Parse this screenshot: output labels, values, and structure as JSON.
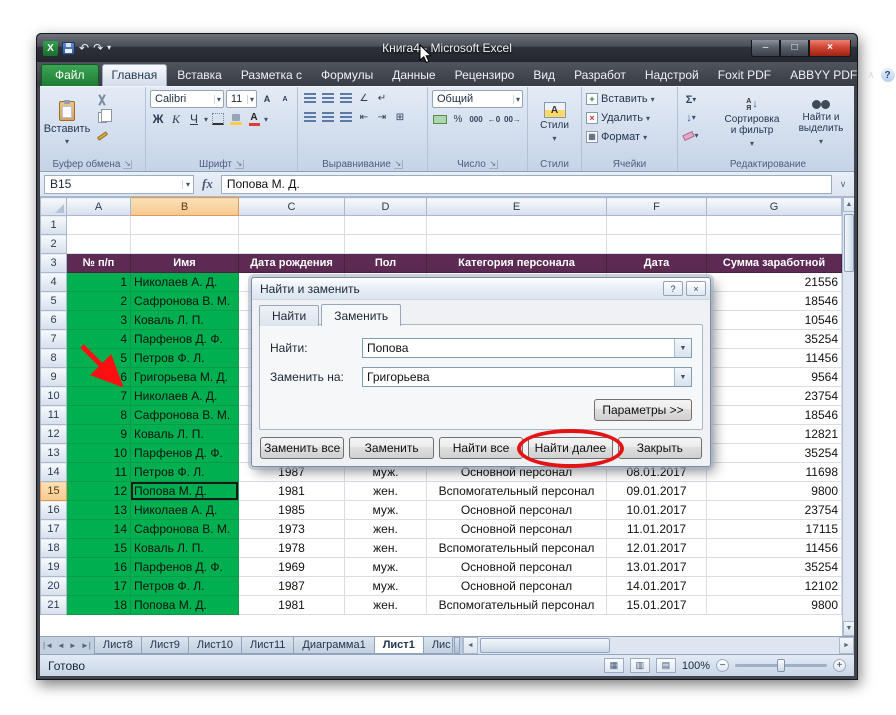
{
  "colors": {
    "cell_green": "#00b050",
    "header_purple": "#5c2a52",
    "annotation_red": "#e51414",
    "selection_orange": "#f6c98f",
    "file_tab_green": "#1d7c35"
  },
  "icons": {
    "dropdown": "▾",
    "dropdown_small": "▼",
    "minimize": "–",
    "maximize": "□",
    "close": "×",
    "help": "?",
    "collapse_ribbon": "∧",
    "undo": "↶",
    "redo": "↷",
    "up": "▲",
    "down": "▼",
    "left": "◄",
    "right": "►",
    "nav_first": "|◄",
    "nav_prev": "◄",
    "nav_next": "►",
    "nav_last": "►|",
    "view_normal": "▦",
    "view_layout": "▥",
    "view_break": "▤",
    "zoom_minus": "−",
    "zoom_plus": "+",
    "formula_expand": "∨",
    "decimal_increase": "←0",
    "decimal_decrease": "00→",
    "wrap_text": "↵",
    "orientation": "∠",
    "merge": "⊞",
    "indent_left": "⇤",
    "indent_right": "⇥",
    "borders": "⊞",
    "fill_arrow": "↓"
  },
  "titlebar": {
    "title": "Книга4  -  Microsoft Excel"
  },
  "ribbon_tabs": [
    {
      "label": "Файл",
      "file": true
    },
    {
      "label": "Главная",
      "active": true
    },
    {
      "label": "Вставка"
    },
    {
      "label": "Разметка с"
    },
    {
      "label": "Формулы"
    },
    {
      "label": "Данные"
    },
    {
      "label": "Рецензиро"
    },
    {
      "label": "Вид"
    },
    {
      "label": "Разработ"
    },
    {
      "label": "Надстрой"
    },
    {
      "label": "Foxit PDF"
    },
    {
      "label": "ABBYY PDF"
    }
  ],
  "ribbon": {
    "clipboard": {
      "label": "Буфер обмена",
      "paste": "Вставить"
    },
    "font": {
      "label": "Шрифт",
      "family": "Calibri",
      "size": "11",
      "bold": "Ж",
      "italic": "К",
      "underline": "Ч",
      "fontcolor": "А",
      "grow": "А",
      "shrink": "А"
    },
    "alignment": {
      "label": "Выравнивание"
    },
    "number": {
      "label": "Число",
      "format": "Общий",
      "percent": "%",
      "thousands": "000"
    },
    "styles": {
      "label": "Стили",
      "button": "Стили",
      "icon_letter": "А"
    },
    "cells": {
      "label": "Ячейки",
      "insert": "Вставить",
      "delete": "Удалить",
      "format": "Формат"
    },
    "editing": {
      "label": "Редактирование",
      "sum": "Σ",
      "sort": "Сортировка и фильтр",
      "find": "Найти и выделить"
    }
  },
  "formula_bar": {
    "name_box": "B15",
    "fx": "fx",
    "value": "Попова М. Д."
  },
  "grid": {
    "columns": [
      "A",
      "B",
      "C",
      "D",
      "E",
      "F",
      "G"
    ],
    "selected_column": "B",
    "selected_row": 15,
    "active_cell": "B15",
    "rows": [
      {
        "num": "1",
        "kind": "empty",
        "cells": [
          "",
          "",
          "",
          "",
          "",
          "",
          ""
        ]
      },
      {
        "num": "2",
        "kind": "empty",
        "cells": [
          "",
          "",
          "",
          "",
          "",
          "",
          ""
        ]
      },
      {
        "num": "3",
        "kind": "header",
        "cells": [
          "№ п/п",
          "Имя",
          "Дата рождения",
          "Пол",
          "Категория персонала",
          "Дата",
          "Сумма заработной"
        ]
      },
      {
        "num": "4",
        "kind": "data",
        "cells": [
          "1",
          "Николаев А. Д.",
          "",
          "",
          "",
          "",
          "21556"
        ]
      },
      {
        "num": "5",
        "kind": "data",
        "cells": [
          "2",
          "Сафронова В. М.",
          "",
          "",
          "",
          "",
          "18546"
        ]
      },
      {
        "num": "6",
        "kind": "data",
        "cells": [
          "3",
          "Коваль Л. П.",
          "",
          "",
          "",
          "",
          "10546"
        ]
      },
      {
        "num": "7",
        "kind": "data",
        "cells": [
          "4",
          "Парфенов Д. Ф.",
          "",
          "",
          "",
          "",
          "35254"
        ]
      },
      {
        "num": "8",
        "kind": "data",
        "cells": [
          "5",
          "Петров Ф. Л.",
          "",
          "",
          "",
          "",
          "11456"
        ]
      },
      {
        "num": "9",
        "kind": "data",
        "cells": [
          "6",
          "Григорьева М. Д.",
          "",
          "",
          "",
          "",
          "9564"
        ]
      },
      {
        "num": "10",
        "kind": "data",
        "cells": [
          "7",
          "Николаев А. Д.",
          "",
          "",
          "",
          "",
          "23754"
        ]
      },
      {
        "num": "11",
        "kind": "data",
        "cells": [
          "8",
          "Сафронова В. М.",
          "",
          "",
          "",
          "",
          "18546"
        ]
      },
      {
        "num": "12",
        "kind": "data",
        "cells": [
          "9",
          "Коваль Л. П.",
          "",
          "",
          "",
          "",
          "12821"
        ]
      },
      {
        "num": "13",
        "kind": "data",
        "cells": [
          "10",
          "Парфенов Д. Ф.",
          "",
          "",
          "",
          "",
          "35254"
        ]
      },
      {
        "num": "14",
        "kind": "data",
        "cells": [
          "11",
          "Петров Ф. Л.",
          "1987",
          "муж.",
          "Основной персонал",
          "08.01.2017",
          "11698"
        ]
      },
      {
        "num": "15",
        "kind": "data",
        "cells": [
          "12",
          "Попова М. Д.",
          "1981",
          "жен.",
          "Вспомогательный персонал",
          "09.01.2017",
          "9800"
        ]
      },
      {
        "num": "16",
        "kind": "data",
        "cells": [
          "13",
          "Николаев А. Д.",
          "1985",
          "муж.",
          "Основной персонал",
          "10.01.2017",
          "23754"
        ]
      },
      {
        "num": "17",
        "kind": "data",
        "cells": [
          "14",
          "Сафронова В. М.",
          "1973",
          "жен.",
          "Основной персонал",
          "11.01.2017",
          "17115"
        ]
      },
      {
        "num": "18",
        "kind": "data",
        "cells": [
          "15",
          "Коваль Л. П.",
          "1978",
          "жен.",
          "Вспомогательный персонал",
          "12.01.2017",
          "11456"
        ]
      },
      {
        "num": "19",
        "kind": "data",
        "cells": [
          "16",
          "Парфенов Д. Ф.",
          "1969",
          "муж.",
          "Основной персонал",
          "13.01.2017",
          "35254"
        ]
      },
      {
        "num": "20",
        "kind": "data",
        "cells": [
          "17",
          "Петров Ф. Л.",
          "1987",
          "муж.",
          "Основной персонал",
          "14.01.2017",
          "12102"
        ]
      },
      {
        "num": "21",
        "kind": "data",
        "cells": [
          "18",
          "Попова М. Д.",
          "1981",
          "жен.",
          "Вспомогательный персонал",
          "15.01.2017",
          "9800"
        ]
      }
    ]
  },
  "dialog": {
    "title": "Найти и заменить",
    "tabs": [
      {
        "label": "Найти"
      },
      {
        "label": "Заменить",
        "active": true
      }
    ],
    "find_label": "Найти:",
    "find_value": "Попова",
    "replace_label": "Заменить на:",
    "replace_value": "Григорьева",
    "options_button": "Параметры >>",
    "buttons": [
      {
        "label": "Заменить все"
      },
      {
        "label": "Заменить"
      },
      {
        "label": "Найти все"
      },
      {
        "label": "Найти далее",
        "circled": true
      },
      {
        "label": "Закрыть"
      }
    ]
  },
  "sheet_tabs": {
    "tabs": [
      {
        "label": "Лист8"
      },
      {
        "label": "Лист9"
      },
      {
        "label": "Лист10"
      },
      {
        "label": "Лист11"
      },
      {
        "label": "Диаграмма1"
      },
      {
        "label": "Лист1",
        "active": true
      },
      {
        "label": "Лис"
      }
    ]
  },
  "status_bar": {
    "ready": "Готово",
    "zoom": "100%"
  }
}
